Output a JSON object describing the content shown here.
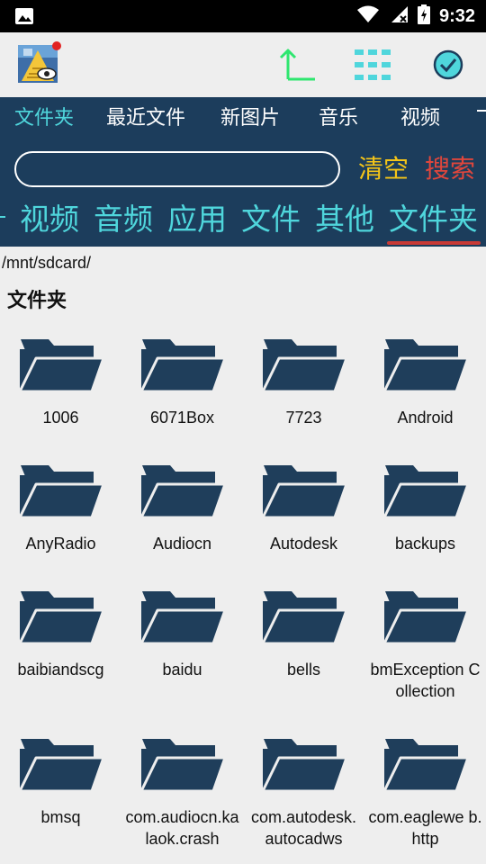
{
  "status_bar": {
    "time": "9:32",
    "icons": [
      "image-icon",
      "wifi-icon",
      "signal-icon",
      "battery-icon"
    ]
  },
  "toolbar": {
    "icons": [
      "app-logo-icon",
      "up-arrow-icon",
      "grid-view-icon",
      "check-circle-icon"
    ]
  },
  "tabs": [
    {
      "label": "文件夹",
      "active": true
    },
    {
      "label": "最近文件",
      "active": false
    },
    {
      "label": "新图片",
      "active": false
    },
    {
      "label": "音乐",
      "active": false
    },
    {
      "label": "视频",
      "active": false
    }
  ],
  "search": {
    "value": "",
    "placeholder": "",
    "clear_label": "清空",
    "search_label": "搜索"
  },
  "categories": [
    {
      "label": "视频"
    },
    {
      "label": "音频"
    },
    {
      "label": "应用"
    },
    {
      "label": "文件"
    },
    {
      "label": "其他"
    },
    {
      "label": "文件夹",
      "active": true
    }
  ],
  "path": "/mnt/sdcard/",
  "section_title": "文件夹",
  "folders": [
    "1006",
    "6071Box",
    "7723",
    "Android",
    "AnyRadio",
    "Audiocn",
    "Autodesk",
    "backups",
    "baibiandscg",
    "baidu",
    "bells",
    "bmException Collection",
    "bmsq",
    "com.audiocn.kalaok.crash",
    "com.autodesk.autocadws",
    "com.eaglewe b.http"
  ],
  "colors": {
    "header_bg": "#1c3d5c",
    "accent_cyan": "#4fd6dc",
    "clear_yellow": "#f5c518",
    "search_red": "#e0463c",
    "folder_navy": "#1f3e5b",
    "background": "#eeeeee"
  }
}
